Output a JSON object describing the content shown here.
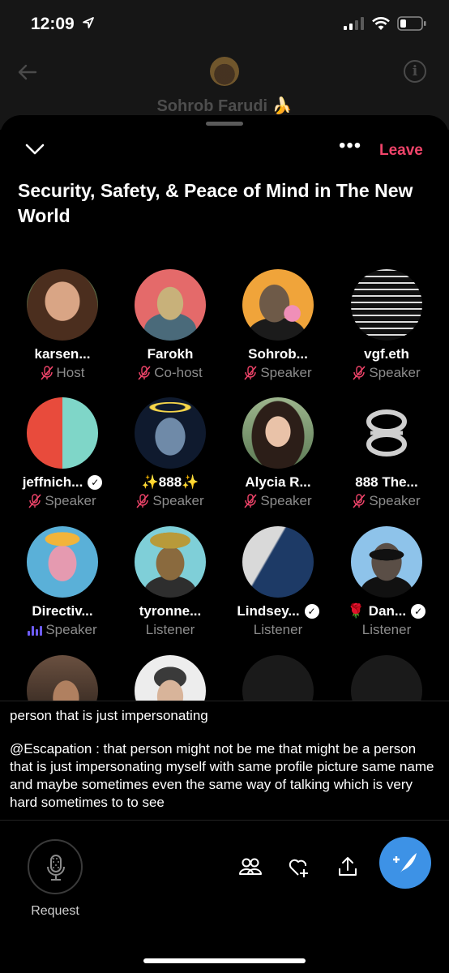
{
  "status_bar": {
    "time": "12:09"
  },
  "chat_header": {
    "name": "Sohrob Farudi 🍌"
  },
  "space": {
    "leave_label": "Leave",
    "more_label": "•••",
    "title": "Security, Safety, & Peace of Mind in The New World"
  },
  "participants": [
    {
      "name": "karsen...",
      "role": "Host",
      "verified": false
    },
    {
      "name": "Farokh",
      "role": "Co-host",
      "verified": false
    },
    {
      "name": "Sohrob...",
      "role": "Speaker",
      "verified": false
    },
    {
      "name": "vgf.eth",
      "role": "Speaker",
      "verified": false
    },
    {
      "name": "jeffnich...",
      "role": "Speaker",
      "verified": true
    },
    {
      "name": "✨888✨",
      "role": "Speaker",
      "verified": false
    },
    {
      "name": "Alycia R...",
      "role": "Speaker",
      "verified": false
    },
    {
      "name": "888 The...",
      "role": "Speaker",
      "verified": false
    },
    {
      "name": "Directiv...",
      "role": "Speaker",
      "verified": false
    },
    {
      "name": "tyronne...",
      "role": "Listener",
      "verified": false
    },
    {
      "name": "Lindsey...",
      "role": "Listener",
      "verified": true
    },
    {
      "name": "🌹 Dan...",
      "role": "Listener",
      "verified": true
    }
  ],
  "caption": {
    "line1": "person that is just impersonating",
    "text": "@Escapation : that person might not be me that might be a person that is just impersonating myself with same profile picture same name and maybe sometimes even the same way of talking which is very hard sometimes to to see"
  },
  "bottom_bar": {
    "request_label": "Request"
  },
  "colors": {
    "leave": "#f0446a",
    "compose": "#3d92e6",
    "speaking": "#6d5cf6"
  }
}
